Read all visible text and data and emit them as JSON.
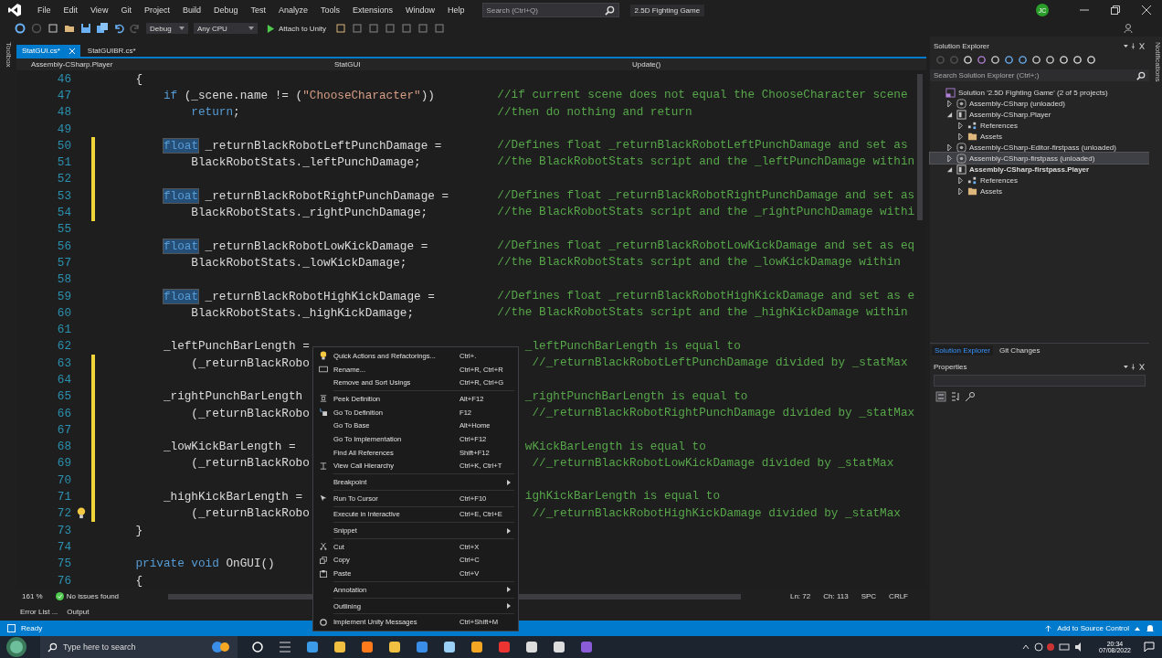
{
  "menu_bar": {
    "items": [
      "File",
      "Edit",
      "View",
      "Git",
      "Project",
      "Build",
      "Debug",
      "Test",
      "Analyze",
      "Tools",
      "Extensions",
      "Window",
      "Help"
    ],
    "search": {
      "placeholder": "Search (Ctrl+Q)"
    },
    "solution_name": "2.5D Fighting Game",
    "avatar": "JC"
  },
  "toolbar": {
    "configuration": "Debug",
    "platform": "Any CPU",
    "run_target": "Attach to Unity"
  },
  "side_strip": "Toolbox",
  "tabs": [
    {
      "label": "StatGUI.cs*",
      "selected": true
    },
    {
      "label": "StatGUIBR.cs*",
      "selected": false
    }
  ],
  "nav_bar": {
    "project": "Assembly-CSharp.Player",
    "class": "StatGUI",
    "member": "Update()"
  },
  "code_lines": [
    {
      "number": "46",
      "changed": false,
      "tokens": [
        {
          "kind": "plain",
          "text": "    {"
        }
      ]
    },
    {
      "number": "47",
      "changed": false,
      "tokens": [
        {
          "kind": "kw",
          "text": "        if"
        },
        {
          "kind": "plain",
          "text": " (_scene.name != ("
        },
        {
          "kind": "str",
          "text": "\"ChooseCharacter\""
        },
        {
          "kind": "plain",
          "text": "))"
        }
      ],
      "comment": {
        "text": "//if current scene does not equal the ChooseCharacter scene",
        "kind": "full"
      }
    },
    {
      "number": "48",
      "changed": false,
      "tokens": [
        {
          "kind": "kw",
          "text": "            return"
        },
        {
          "kind": "plain",
          "text": ";"
        }
      ],
      "comment": {
        "text": "//then do nothing and return",
        "kind": "full"
      }
    },
    {
      "number": "49",
      "changed": false
    },
    {
      "number": "50",
      "changed": true,
      "tokens": [
        {
          "kind": "sel",
          "text": "        float"
        },
        {
          "kind": "plain",
          "text": " _returnBlackRobotLeftPunchDamage ="
        }
      ],
      "comment": {
        "text": "//Defines float _returnBlackRobotLeftPunchDamage and set as",
        "kind": "full"
      }
    },
    {
      "number": "51",
      "changed": true,
      "tokens": [
        {
          "kind": "plain",
          "text": "            BlackRobotStats._leftPunchDamage;"
        }
      ],
      "comment": {
        "text": "//the BlackRobotStats script and the _leftPunchDamage within",
        "kind": "full"
      }
    },
    {
      "number": "52",
      "changed": true
    },
    {
      "number": "53",
      "changed": true,
      "tokens": [
        {
          "kind": "sel",
          "text": "        float"
        },
        {
          "kind": "plain",
          "text": " _returnBlackRobotRightPunchDamage ="
        }
      ],
      "comment": {
        "text": "//Defines float _returnBlackRobotRightPunchDamage and set as",
        "kind": "full"
      }
    },
    {
      "number": "54",
      "changed": true,
      "tokens": [
        {
          "kind": "plain",
          "text": "            BlackRobotStats._rightPunchDamage;"
        }
      ],
      "comment": {
        "text": "//the BlackRobotStats script and the _rightPunchDamage withi",
        "kind": "full"
      }
    },
    {
      "number": "55",
      "changed": false
    },
    {
      "number": "56",
      "changed": false,
      "tokens": [
        {
          "kind": "sel",
          "text": "        float"
        },
        {
          "kind": "plain",
          "text": " _returnBlackRobotLowKickDamage ="
        }
      ],
      "comment": {
        "text": "//Defines float _returnBlackRobotLowKickDamage and set as eq",
        "kind": "full"
      }
    },
    {
      "number": "57",
      "changed": false,
      "tokens": [
        {
          "kind": "plain",
          "text": "            BlackRobotStats._lowKickDamage;"
        }
      ],
      "comment": {
        "text": "//the BlackRobotStats script and the _lowKickDamage within",
        "kind": "full"
      }
    },
    {
      "number": "58",
      "changed": false
    },
    {
      "number": "59",
      "changed": false,
      "tokens": [
        {
          "kind": "sel",
          "text": "        float"
        },
        {
          "kind": "plain",
          "text": " _returnBlackRobotHighKickDamage ="
        }
      ],
      "comment": {
        "text": "//Defines float _returnBlackRobotHighKickDamage and set as e",
        "kind": "full"
      }
    },
    {
      "number": "60",
      "changed": false,
      "tokens": [
        {
          "kind": "plain",
          "text": "            BlackRobotStats._highKickDamage;"
        }
      ],
      "comment": {
        "text": "//the BlackRobotStats script and the _highKickDamage within",
        "kind": "full"
      }
    },
    {
      "number": "61",
      "changed": false
    },
    {
      "number": "62",
      "changed": false,
      "tokens": [
        {
          "kind": "plain",
          "text": "        _leftPunchBarLength ="
        }
      ],
      "comment": {
        "text": "_leftPunchBarLength is equal to",
        "kind": "after-menu"
      }
    },
    {
      "number": "63",
      "changed": true,
      "tokens": [
        {
          "kind": "plain",
          "text": "            (_returnBlackRobo"
        }
      ],
      "comment": {
        "text": "//_returnBlackRobotLeftPunchDamage divided by _statMax",
        "kind": "after-menu-far"
      }
    },
    {
      "number": "64",
      "changed": true
    },
    {
      "number": "65",
      "changed": true,
      "tokens": [
        {
          "kind": "plain",
          "text": "        _rightPunchBarLength"
        }
      ],
      "comment": {
        "text": "_rightPunchBarLength is equal to",
        "kind": "after-menu"
      }
    },
    {
      "number": "66",
      "changed": true,
      "tokens": [
        {
          "kind": "plain",
          "text": "            (_returnBlackRobo"
        }
      ],
      "comment": {
        "text": "//_returnBlackRobotRightPunchDamage divided by _statMax",
        "kind": "after-menu-far"
      }
    },
    {
      "number": "67",
      "changed": true
    },
    {
      "number": "68",
      "changed": true,
      "tokens": [
        {
          "kind": "plain",
          "text": "        _lowKickBarLength ="
        }
      ],
      "comment": {
        "text": "wKickBarLength is equal to",
        "kind": "after-menu"
      }
    },
    {
      "number": "69",
      "changed": true,
      "tokens": [
        {
          "kind": "plain",
          "text": "            (_returnBlackRobo"
        }
      ],
      "comment": {
        "text": "//_returnBlackRobotLowKickDamage divided by _statMax",
        "kind": "after-menu-far"
      }
    },
    {
      "number": "70",
      "changed": true
    },
    {
      "number": "71",
      "changed": true,
      "tokens": [
        {
          "kind": "plain",
          "text": "        _highKickBarLength ="
        }
      ],
      "comment": {
        "text": "ighKickBarLength is equal to",
        "kind": "after-menu"
      }
    },
    {
      "number": "72",
      "changed": true,
      "lightbulb": true,
      "tokens": [
        {
          "kind": "plain",
          "text": "            (_returnBlackRobo"
        }
      ],
      "comment": {
        "text": "//_returnBlackRobotHighKickDamage divided by _statMax",
        "kind": "after-menu-far"
      }
    },
    {
      "number": "73",
      "changed": false,
      "tokens": [
        {
          "kind": "plain",
          "text": "    }"
        }
      ]
    },
    {
      "number": "74",
      "changed": false
    },
    {
      "number": "75",
      "changed": false,
      "tokens": [
        {
          "kind": "kw",
          "text": "    private void"
        },
        {
          "kind": "plain",
          "text": " OnGUI()"
        }
      ]
    },
    {
      "number": "76",
      "changed": false,
      "tokens": [
        {
          "kind": "plain",
          "text": "    {"
        }
      ]
    }
  ],
  "context_menu": [
    {
      "kind": "item",
      "label": "Quick Actions and Refactorings...",
      "shortcut": "Ctrl+."
    },
    {
      "kind": "item",
      "label": "Rename...",
      "shortcut": "Ctrl+R, Ctrl+R"
    },
    {
      "kind": "item",
      "label": "Remove and Sort Usings",
      "shortcut": "Ctrl+R, Ctrl+G"
    },
    {
      "kind": "separator"
    },
    {
      "kind": "item",
      "label": "Peek Definition",
      "shortcut": "Alt+F12"
    },
    {
      "kind": "item",
      "label": "Go To Definition",
      "shortcut": "F12"
    },
    {
      "kind": "item",
      "label": "Go To Base",
      "shortcut": "Alt+Home"
    },
    {
      "kind": "item",
      "label": "Go To Implementation",
      "shortcut": "Ctrl+F12"
    },
    {
      "kind": "item",
      "label": "Find All References",
      "shortcut": "Shift+F12"
    },
    {
      "kind": "item",
      "label": "View Call Hierarchy",
      "shortcut": "Ctrl+K, Ctrl+T"
    },
    {
      "kind": "separator"
    },
    {
      "kind": "submenu",
      "label": "Breakpoint"
    },
    {
      "kind": "separator"
    },
    {
      "kind": "item",
      "label": "Run To Cursor",
      "shortcut": "Ctrl+F10"
    },
    {
      "kind": "separator"
    },
    {
      "kind": "item",
      "label": "Execute in Interactive",
      "shortcut": "Ctrl+E, Ctrl+E"
    },
    {
      "kind": "separator"
    },
    {
      "kind": "submenu",
      "label": "Snippet"
    },
    {
      "kind": "separator"
    },
    {
      "kind": "item",
      "label": "Cut",
      "shortcut": "Ctrl+X"
    },
    {
      "kind": "item",
      "label": "Copy",
      "shortcut": "Ctrl+C"
    },
    {
      "kind": "item",
      "label": "Paste",
      "shortcut": "Ctrl+V"
    },
    {
      "kind": "separator"
    },
    {
      "kind": "submenu",
      "label": "Annotation"
    },
    {
      "kind": "separator"
    },
    {
      "kind": "submenu",
      "label": "Outlining"
    },
    {
      "kind": "separator"
    },
    {
      "kind": "item",
      "label": "Implement Unity Messages",
      "shortcut": "Ctrl+Shift+M"
    }
  ],
  "editor_status": {
    "zoom": "161 %",
    "issues": "No issues found",
    "line": "Ln: 72",
    "column": "Ch: 113",
    "whitespace": "SPC",
    "line_endings": "CRLF"
  },
  "bottom_tabs": [
    "Error List ...",
    "Output"
  ],
  "solution_explorer": {
    "title": "Solution Explorer",
    "search": {
      "placeholder": "Search Solution Explorer (Ctrl+;)"
    },
    "tree": [
      {
        "kind": "solution",
        "label": "Solution '2.5D Fighting Game' (2 of 5 projects)",
        "selected": false,
        "bold": false,
        "children": [
          {
            "kind": "unloaded",
            "label": "Assembly-CSharp (unloaded)",
            "expanded": false,
            "selected": false,
            "bold": false
          },
          {
            "kind": "project",
            "label": "Assembly-CSharp.Player",
            "expanded": true,
            "selected": false,
            "bold": false,
            "children": [
              {
                "kind": "references",
                "label": "References",
                "expanded": false,
                "selected": false,
                "bold": false
              },
              {
                "kind": "folder",
                "label": "Assets",
                "expanded": false,
                "selected": false,
                "bold": false
              }
            ]
          },
          {
            "kind": "unloaded",
            "label": "Assembly-CSharp-Editor-firstpass (unloaded)",
            "expanded": false,
            "selected": false,
            "bold": false
          },
          {
            "kind": "unloaded",
            "label": "Assembly-CSharp-firstpass (unloaded)",
            "expanded": false,
            "selected": true,
            "bold": false
          },
          {
            "kind": "project",
            "label": "Assembly-CSharp-firstpass.Player",
            "expanded": true,
            "selected": false,
            "bold": true,
            "children": [
              {
                "kind": "references",
                "label": "References",
                "expanded": false,
                "selected": false,
                "bold": false
              },
              {
                "kind": "folder",
                "label": "Assets",
                "expanded": false,
                "selected": false,
                "bold": false
              }
            ]
          }
        ]
      }
    ],
    "tabs": [
      {
        "label": "Solution Explorer",
        "selected": true
      },
      {
        "label": "Git Changes",
        "selected": false
      }
    ]
  },
  "properties": {
    "title": "Properties"
  },
  "notifications_strip": "Notifications",
  "status_bar": {
    "state": "Ready",
    "source_control": "Add to Source Control"
  },
  "taskbar": {
    "search": {
      "placeholder": "Type here to search"
    },
    "time": "20:34",
    "date": "07/08/2022"
  }
}
